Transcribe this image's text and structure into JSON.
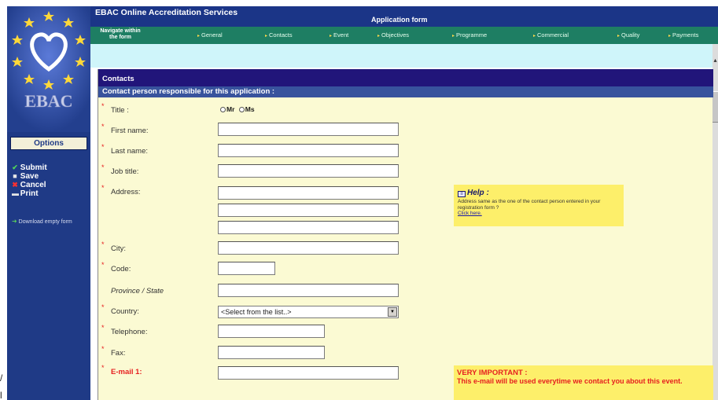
{
  "sidebar": {
    "logo_text": "EBAC",
    "options_title": "Options",
    "options": [
      {
        "label": "Submit",
        "icon": "check-icon"
      },
      {
        "label": "Save",
        "icon": "disk-icon"
      },
      {
        "label": "Cancel",
        "icon": "cross-icon"
      },
      {
        "label": "Print",
        "icon": "printer-icon"
      }
    ],
    "download_label": "Download empty form"
  },
  "header": {
    "app_title": "EBAC Online Accreditation Services",
    "form_title": "Application form"
  },
  "nav": {
    "label": "Navigate within the form",
    "items": [
      "General",
      "Contacts",
      "Event",
      "Objectives",
      "Programme",
      "Commercial",
      "Quality",
      "Payments"
    ]
  },
  "form": {
    "section_title": "Contacts",
    "subsection_title": "Contact person responsible for this application :",
    "title_label": "Title :",
    "title_options": [
      "Mr",
      "Ms"
    ],
    "first_name_label": "First name:",
    "last_name_label": "Last name:",
    "job_title_label": "Job title:",
    "address_label": "Address:",
    "city_label": "City:",
    "code_label": "Code:",
    "province_label": "Province / State",
    "country_label": "Country:",
    "country_value": "<Select from the list..>",
    "telephone_label": "Telephone:",
    "fax_label": "Fax:",
    "email_label": "E-mail 1:"
  },
  "help": {
    "title": "Help :",
    "text": "Address same as the one of the contact person entered in your registration form ?",
    "link": "Click here."
  },
  "important": {
    "title": "VERY IMPORTANT :",
    "text": "This e-mail will be used everytime we contact you about this event."
  },
  "colors": {
    "sidebar_bg": "#1f3a86",
    "nav_bg": "#1e7e63",
    "panel_bg": "#fbfad3",
    "section_header": "#21157a",
    "subsection_header": "#38539d",
    "required": "#e62020",
    "highlight_box": "#fdef6a"
  }
}
